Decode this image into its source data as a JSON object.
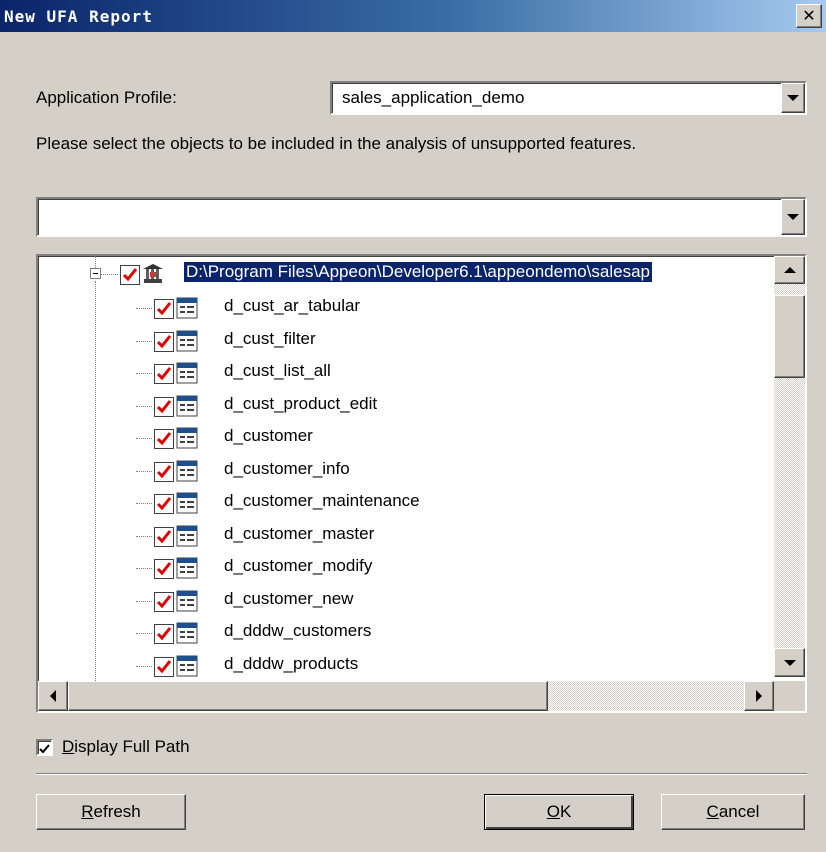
{
  "window": {
    "title": "New UFA Report",
    "close_glyph": "✕"
  },
  "profile": {
    "label": "Application Profile:",
    "value": "sales_application_demo"
  },
  "instruction": "Please select the objects to be included in the analysis of unsupported features.",
  "filter": {
    "value": ""
  },
  "tree": {
    "root": {
      "label": "D:\\Program Files\\Appeon\\Developer6.1\\appeondemo\\salesap",
      "checked": true,
      "icon": "library-icon"
    },
    "items": [
      {
        "label": "d_cust_ar_tabular",
        "checked": true,
        "icon": "datawindow-icon"
      },
      {
        "label": "d_cust_filter",
        "checked": true,
        "icon": "datawindow-icon"
      },
      {
        "label": "d_cust_list_all",
        "checked": true,
        "icon": "datawindow-icon"
      },
      {
        "label": "d_cust_product_edit",
        "checked": true,
        "icon": "datawindow-icon"
      },
      {
        "label": "d_customer",
        "checked": true,
        "icon": "datawindow-icon"
      },
      {
        "label": "d_customer_info",
        "checked": true,
        "icon": "datawindow-icon"
      },
      {
        "label": "d_customer_maintenance",
        "checked": true,
        "icon": "datawindow-icon"
      },
      {
        "label": "d_customer_master",
        "checked": true,
        "icon": "datawindow-icon"
      },
      {
        "label": "d_customer_modify",
        "checked": true,
        "icon": "datawindow-icon"
      },
      {
        "label": "d_customer_new",
        "checked": true,
        "icon": "datawindow-icon"
      },
      {
        "label": "d_dddw_customers",
        "checked": true,
        "icon": "datawindow-icon"
      },
      {
        "label": "d_dddw_products",
        "checked": true,
        "icon": "datawindow-icon"
      }
    ]
  },
  "display_full_path": {
    "label_prefix": "D",
    "label_rest": "isplay Full Path",
    "checked": true
  },
  "buttons": {
    "refresh": {
      "mnemonic": "R",
      "rest": "efresh"
    },
    "ok": {
      "mnemonic": "O",
      "rest": "K"
    },
    "cancel": {
      "mnemonic": "C",
      "rest": "ancel"
    }
  },
  "colors": {
    "title_start": "#0a246a",
    "title_end": "#a6caf0",
    "check": "#e00000",
    "dialog_bg": "#d4d0c8"
  }
}
